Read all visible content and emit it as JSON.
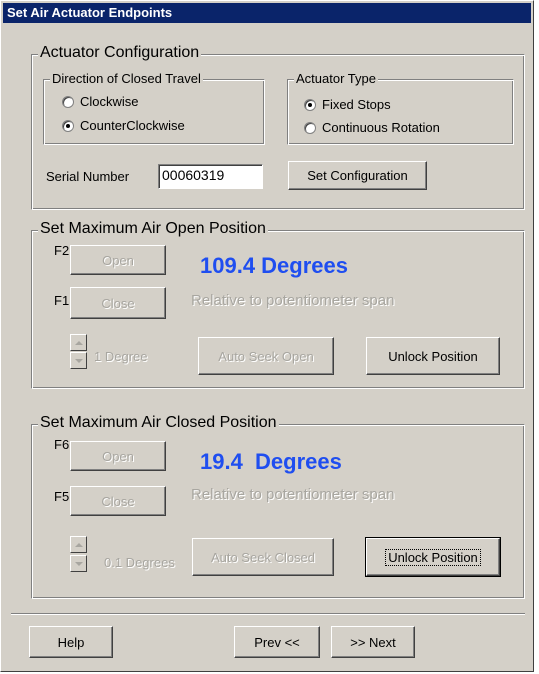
{
  "window": {
    "title": "Set Air Actuator Endpoints"
  },
  "config": {
    "group_title": "Actuator Configuration",
    "direction": {
      "title": "Direction of Closed Travel",
      "options": [
        "Clockwise",
        "CounterClockwise"
      ],
      "selected": "CounterClockwise"
    },
    "actuator_type": {
      "title": "Actuator Type",
      "options": [
        "Fixed Stops",
        "Continuous Rotation"
      ],
      "selected": "Fixed Stops"
    },
    "serial_label": "Serial Number",
    "serial_value": "00060319",
    "set_config_label": "Set Configuration"
  },
  "open_position": {
    "title": "Set Maximum Air Open Position",
    "f_open_key": "F2",
    "f_close_key": "F1",
    "open_label": "Open",
    "close_label": "Close",
    "degrees": "109.4 Degrees",
    "relative": "Relative to potentiometer span",
    "step": "1 Degree",
    "auto_seek_label": "Auto Seek Open",
    "unlock_label": "Unlock Position"
  },
  "closed_position": {
    "title": "Set Maximum Air Closed Position",
    "f_open_key": "F6",
    "f_close_key": "F5",
    "open_label": "Open",
    "close_label": "Close",
    "degrees": "19.4  Degrees",
    "relative": "Relative to potentiometer span",
    "step": "0.1 Degrees",
    "auto_seek_label": "Auto Seek Closed",
    "unlock_label": "Unlock Position"
  },
  "footer": {
    "help_label": "Help",
    "prev_label": "Prev <<",
    "next_label": ">> Next"
  },
  "colors": {
    "title_bar": "#0a246a",
    "face": "#d4d0c8",
    "degrees_text": "#1f4ef0",
    "disabled_text": "#a8a6a0"
  }
}
